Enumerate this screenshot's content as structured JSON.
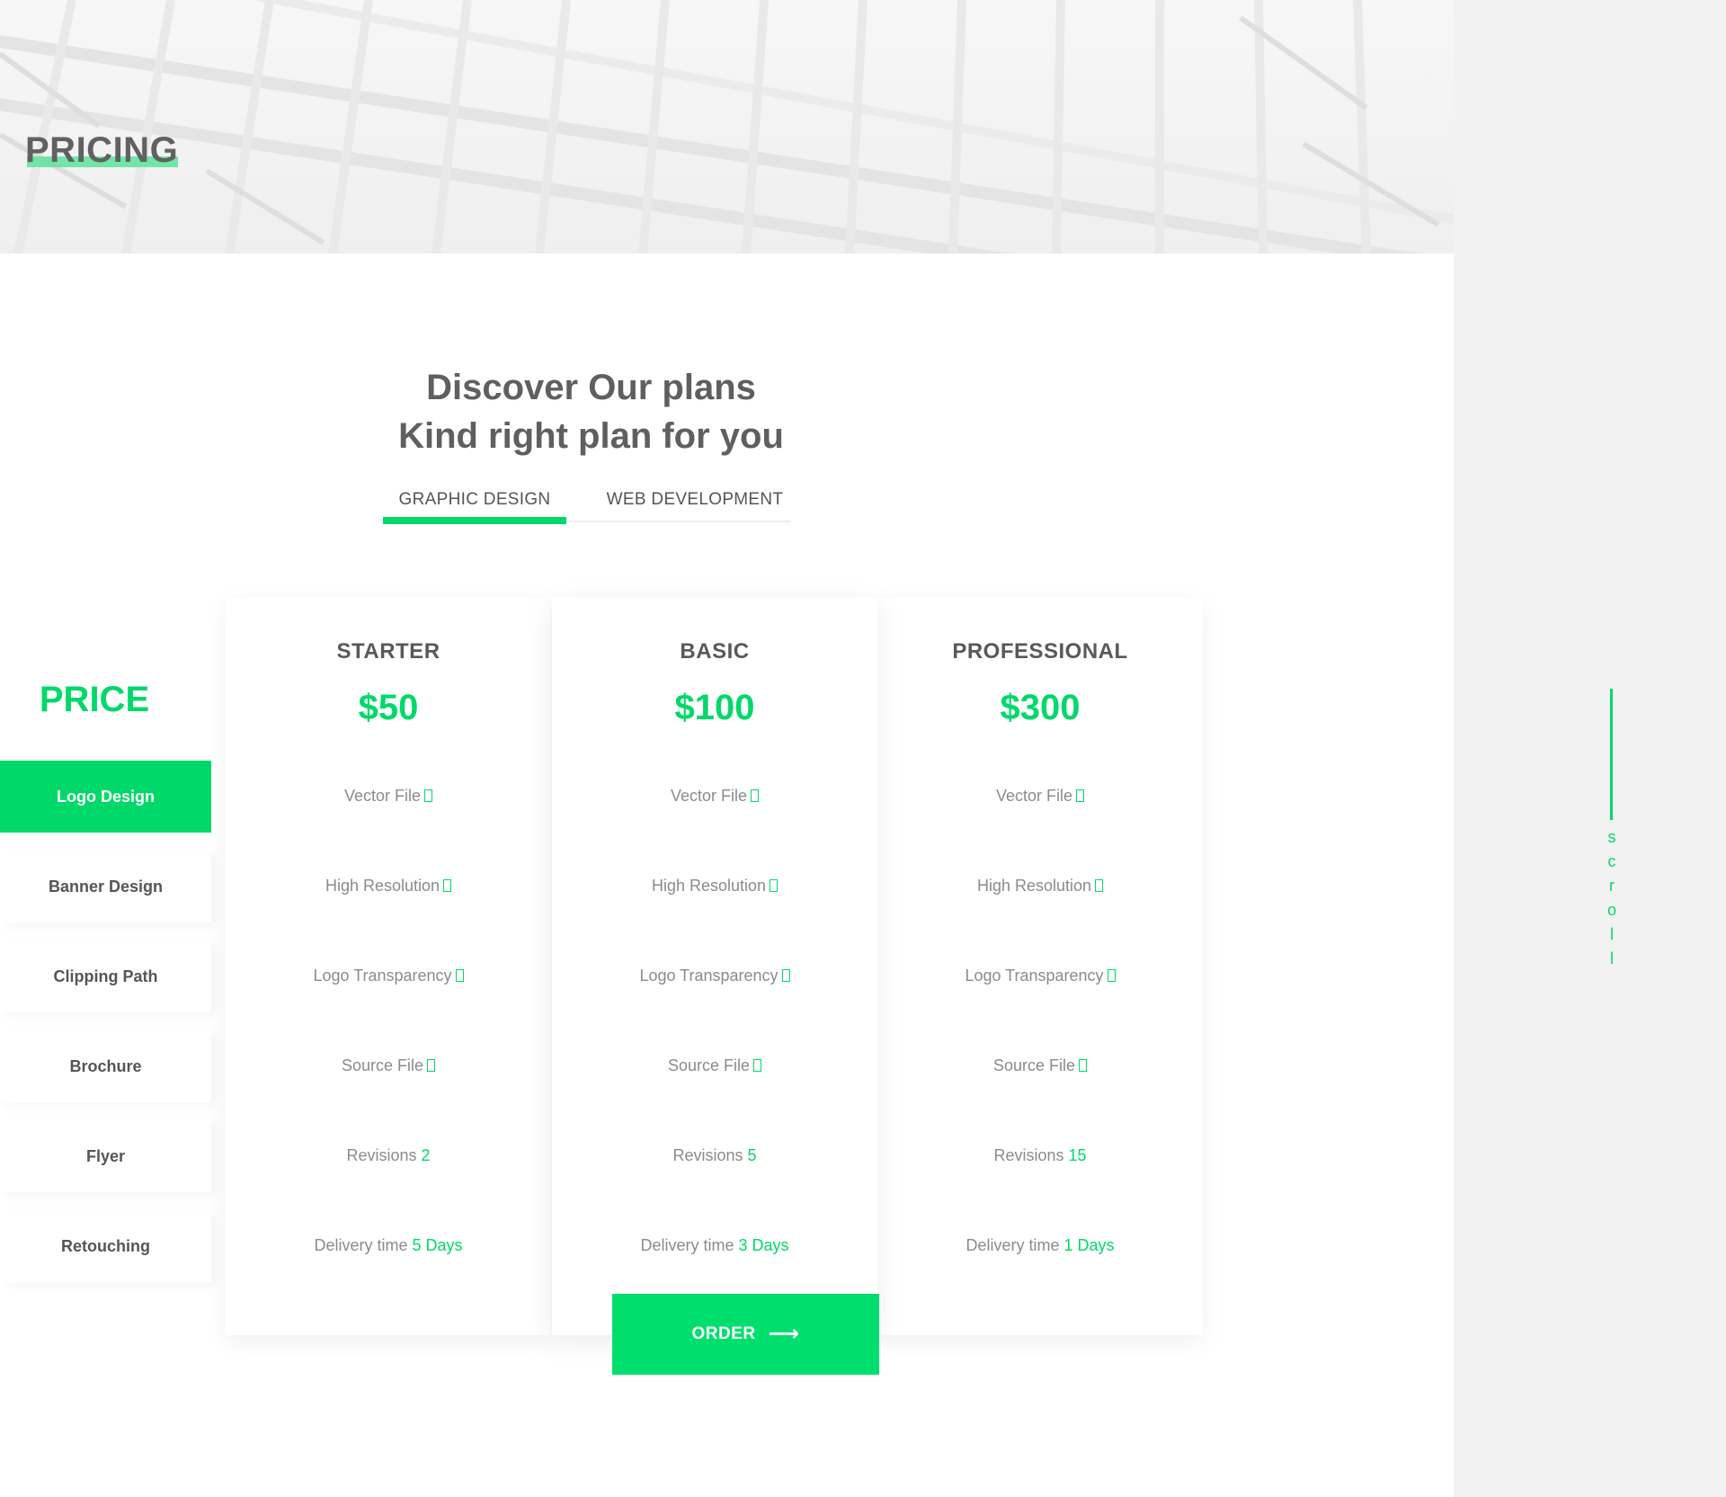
{
  "hero": {
    "title": "PRICING"
  },
  "headline": {
    "line1": "Discover Our plans",
    "line2": "Kind right plan for you"
  },
  "tabs": [
    {
      "label": "GRAPHIC DESIGN",
      "active": true
    },
    {
      "label": "WEB DEVELOPMENT",
      "active": false
    }
  ],
  "sidebar": {
    "price_label": "PRICE",
    "items": [
      {
        "label": "Logo Design",
        "active": true
      },
      {
        "label": "Banner Design",
        "active": false
      },
      {
        "label": "Clipping Path",
        "active": false
      },
      {
        "label": "Brochure",
        "active": false
      },
      {
        "label": "Flyer",
        "active": false
      },
      {
        "label": "Retouching",
        "active": false
      }
    ]
  },
  "plans": [
    {
      "name": "STARTER",
      "price": "$50",
      "features": {
        "vector": "Vector File",
        "resolution": "High Resolution",
        "transparency": "Logo Transparency",
        "source": "Source File",
        "revisions_label": "Revisions",
        "revisions_value": "2",
        "delivery_label": "Delivery time",
        "delivery_value": "5 Days"
      }
    },
    {
      "name": "BASIC",
      "price": "$100",
      "features": {
        "vector": "Vector File",
        "resolution": "High Resolution",
        "transparency": "Logo Transparency",
        "source": "Source File",
        "revisions_label": "Revisions",
        "revisions_value": "5",
        "delivery_label": "Delivery time",
        "delivery_value": "3 Days"
      }
    },
    {
      "name": "PROFESSIONAL",
      "price": "$300",
      "features": {
        "vector": "Vector File",
        "resolution": "High Resolution",
        "transparency": "Logo Transparency",
        "source": "Source File",
        "revisions_label": "Revisions",
        "revisions_value": "15",
        "delivery_label": "Delivery time",
        "delivery_value": "1 Days"
      }
    }
  ],
  "order_button": {
    "label": "ORDER",
    "icon": "arrow-right-icon"
  },
  "scroll": {
    "label": "scroll"
  },
  "colors": {
    "accent": "#00d969",
    "text": "#5f5f5f",
    "muted": "#8b8b8b",
    "rail": "#f2f2f2"
  }
}
